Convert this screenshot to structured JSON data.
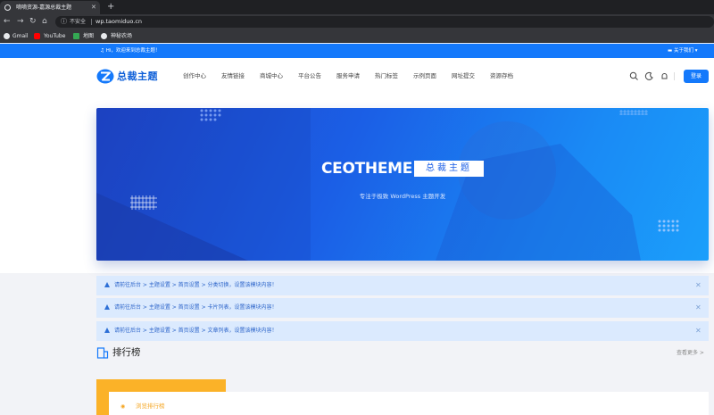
{
  "browser": {
    "tab_title": "嘀嘀资源-嘉源总裁主题",
    "new_tab": "+",
    "insecure_label": "不安全",
    "url": "wp.taomiduo.cn",
    "bookmarks": [
      {
        "label": "Gmail"
      },
      {
        "label": "YouTube"
      },
      {
        "label": "地图"
      },
      {
        "label": "神秘农场"
      }
    ]
  },
  "site": {
    "welcome": "Hi，欢迎来到总裁主题！",
    "about": "关于我们",
    "logo_text": "总裁主题",
    "nav": [
      "创作中心",
      "友情链接",
      "商城中心",
      "平台公告",
      "服务申请",
      "热门标签",
      "示例页面",
      "网址提交",
      "资源存档"
    ],
    "login": "登录",
    "colors": {
      "primary": "#1479fb",
      "notice_bg": "#dbeafe",
      "accent_orange": "#fbb228"
    }
  },
  "banner": {
    "title": "CEOTHEME",
    "tag": "总裁主题",
    "subtitle": "专注于极致 WordPress 主题开发"
  },
  "notices": [
    {
      "text": "请前往后台 > 主题设置 > 首页设置 > 分类切换，设置该模块内容！"
    },
    {
      "text": "请前往后台 > 主题设置 > 首页设置 > 卡片列表，设置该模块内容！"
    },
    {
      "text": "请前往后台 > 主题设置 > 首页设置 > 文章列表，设置该模块内容！"
    }
  ],
  "ranking": {
    "title": "排行榜",
    "more": "查看更多 >",
    "tab_label": "浏览排行榜"
  }
}
